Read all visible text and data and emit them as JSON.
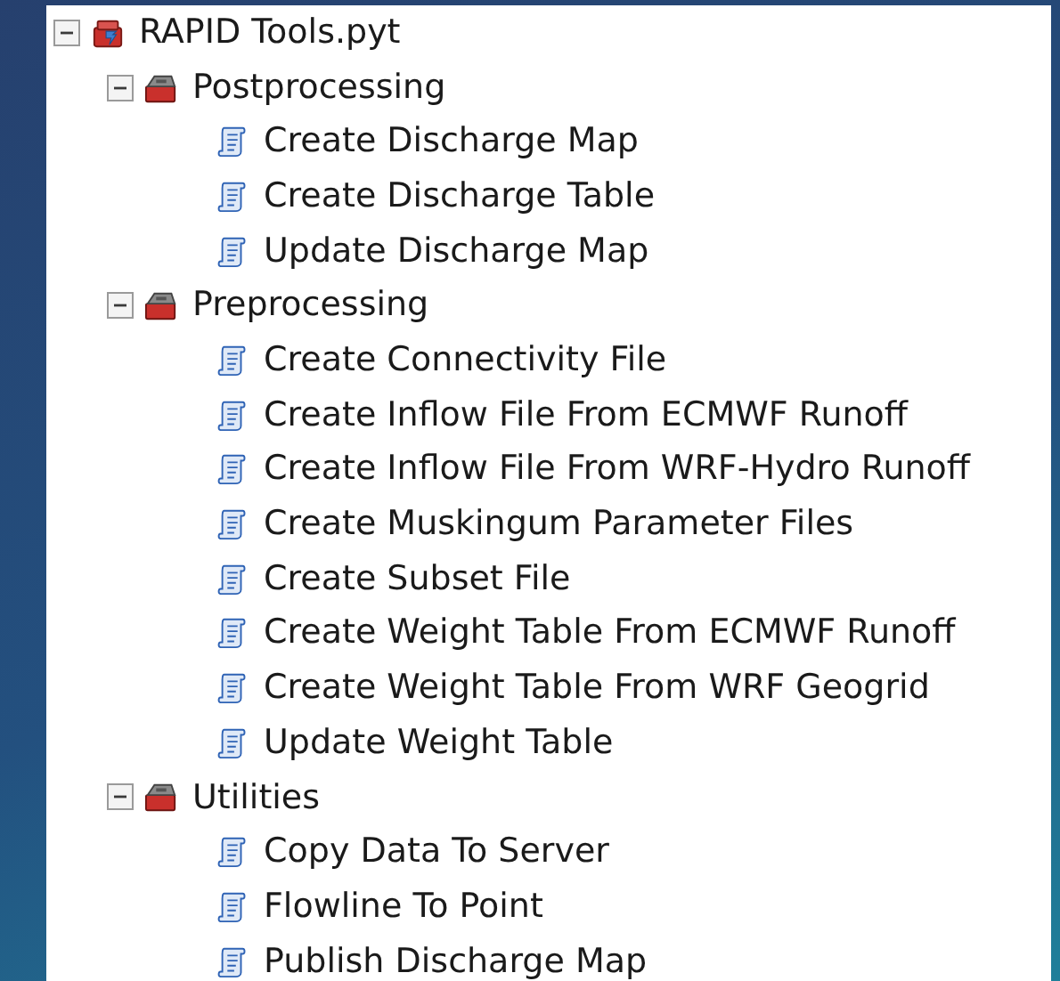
{
  "tree": [
    {
      "label": "RAPID Tools.pyt",
      "kind": "toolbox",
      "expanded": true,
      "children": [
        {
          "label": "Postprocessing",
          "kind": "toolset",
          "expanded": true,
          "children": [
            {
              "label": "Create Discharge Map",
              "kind": "script"
            },
            {
              "label": "Create Discharge Table",
              "kind": "script"
            },
            {
              "label": "Update Discharge Map",
              "kind": "script"
            }
          ]
        },
        {
          "label": "Preprocessing",
          "kind": "toolset",
          "expanded": true,
          "children": [
            {
              "label": "Create Connectivity File",
              "kind": "script"
            },
            {
              "label": "Create Inflow File From ECMWF Runoff",
              "kind": "script"
            },
            {
              "label": "Create Inflow File From WRF-Hydro Runoff",
              "kind": "script"
            },
            {
              "label": "Create Muskingum Parameter Files",
              "kind": "script"
            },
            {
              "label": "Create Subset File",
              "kind": "script"
            },
            {
              "label": "Create Weight Table From ECMWF Runoff",
              "kind": "script"
            },
            {
              "label": "Create Weight Table From WRF Geogrid",
              "kind": "script"
            },
            {
              "label": "Update Weight Table",
              "kind": "script"
            }
          ]
        },
        {
          "label": "Utilities",
          "kind": "toolset",
          "expanded": true,
          "children": [
            {
              "label": "Copy Data To Server",
              "kind": "script"
            },
            {
              "label": "Flowline To Point",
              "kind": "script"
            },
            {
              "label": "Publish Discharge Map",
              "kind": "script"
            }
          ]
        }
      ]
    }
  ]
}
